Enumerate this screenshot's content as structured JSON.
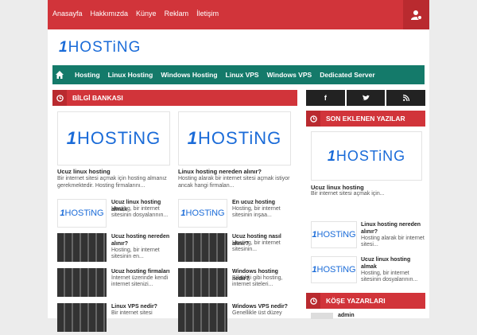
{
  "topbar": {
    "items": [
      "Anasayfa",
      "Hakkımızda",
      "Künye",
      "Reklam",
      "İletişim"
    ]
  },
  "logo": {
    "one": "1",
    "text": "HOSTiNG"
  },
  "mainnav": {
    "items": [
      "Hosting",
      "Linux Hosting",
      "Windows Hosting",
      "Linux VPS",
      "Windows VPS",
      "Dedicated Server"
    ]
  },
  "left": {
    "heading": "BİLGİ BANKASI",
    "cards": [
      {
        "title": "Ucuz linux hosting",
        "desc": "Bir internet sitesi açmak için hosting almanız gerekmektedir. Hosting firmalarını..."
      },
      {
        "title": "Linux hosting nereden alınır?",
        "desc": "Hosting alarak bir internet sitesi açmak istiyor ancak hangi firmalan..."
      }
    ],
    "minis": [
      {
        "title": "Ucuz linux hosting almak",
        "desc": "Hosting, bir internet sitesinin dosyalarının..."
      },
      {
        "title": "En ucuz hosting",
        "desc": "Hosting, bir internet sitesinin inşaa..."
      },
      {
        "title": "Ucuz hosting nereden alınır?",
        "desc": "Hosting, bir internet sitesinin en..."
      },
      {
        "title": "Ucuz hosting nasıl alınır?",
        "desc": "Hosting, bir internet sitesinin..."
      },
      {
        "title": "Ucuz hosting firmaları",
        "desc": "İnternet üzerinde kendi internet sitenizi..."
      },
      {
        "title": "Windows hosting nedir?",
        "desc": "Bilindiği gibi hosting, internet siteleri..."
      },
      {
        "title": "Linux VPS nedir?",
        "desc": "Bir internet sitesi"
      },
      {
        "title": "Windows VPS nedir?",
        "desc": "Genellikle üst düzey"
      }
    ]
  },
  "right": {
    "social": [
      "f",
      "t",
      "rss"
    ],
    "heading": "SON EKLENEN YAZILAR",
    "feature": {
      "title": "Ucuz linux hosting",
      "desc": "Bir internet sitesi açmak için..."
    },
    "minis": [
      {
        "title": "Linux hosting nereden alınır?",
        "desc": "Hosting alarak bir internet sitesi..."
      },
      {
        "title": "Ucuz linux hosting almak",
        "desc": "Hosting, bir internet sitesinin dosyalarının..."
      }
    ],
    "heading2": "KÖŞE YAZARLARI",
    "author": "admin"
  }
}
